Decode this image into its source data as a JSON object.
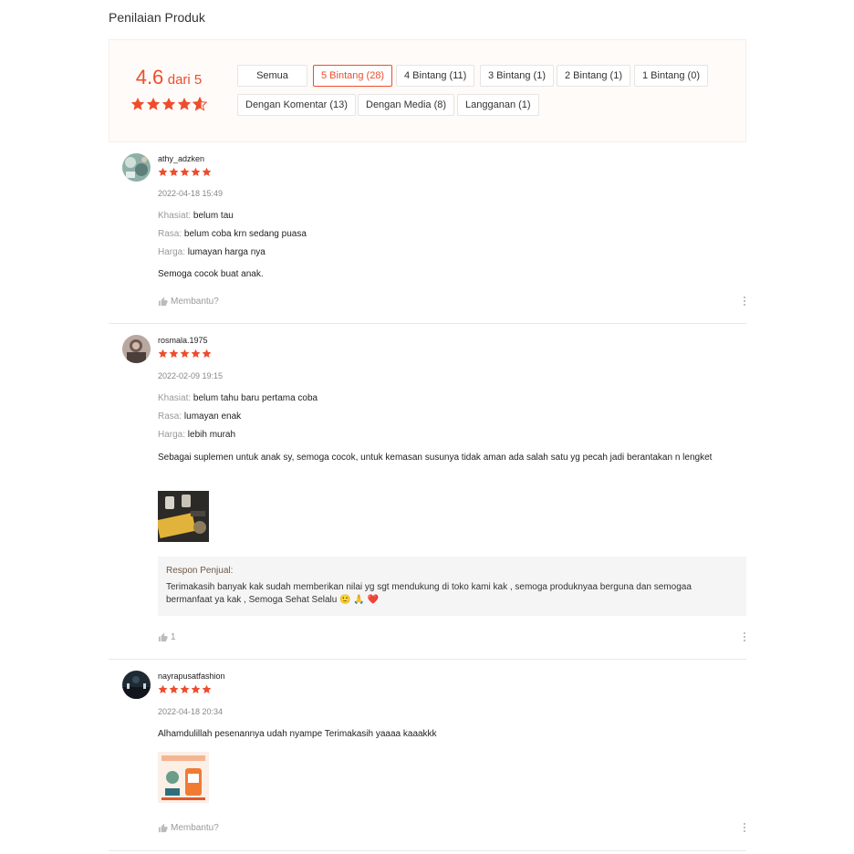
{
  "section_title": "Penilaian Produk",
  "overview": {
    "score": "4.6",
    "score_suffix": "dari 5",
    "rating_value": 4.6,
    "filters": [
      {
        "label": "Semua",
        "active": false
      },
      {
        "label": "5 Bintang (28)",
        "active": true
      },
      {
        "label": "4 Bintang (11)",
        "active": false
      },
      {
        "label": "3 Bintang (1)",
        "active": false
      },
      {
        "label": "2 Bintang (1)",
        "active": false
      },
      {
        "label": "1 Bintang (0)",
        "active": false
      },
      {
        "label": "Dengan Komentar (13)",
        "active": false
      },
      {
        "label": "Dengan Media (8)",
        "active": false
      },
      {
        "label": "Langganan (1)",
        "active": false
      }
    ]
  },
  "colors": {
    "accent": "#ee4d2d",
    "reply_title": "#6d5848"
  },
  "reviews": [
    {
      "username": "athy_adzken",
      "stars": 5,
      "date": "2022-04-18 15:49",
      "attributes": [
        {
          "key": "Khasiat:",
          "value": "belum tau"
        },
        {
          "key": "Rasa:",
          "value": "belum coba krn sedang puasa"
        },
        {
          "key": "Harga:",
          "value": "lumayan harga nya"
        }
      ],
      "comment": "Semoga cocok buat anak.",
      "helpful": "Membantu?",
      "icons": [
        "thumbs-up-icon",
        "more-vertical-icon"
      ]
    },
    {
      "username": "rosmala.1975",
      "stars": 5,
      "date": "2022-02-09 19:15",
      "attributes": [
        {
          "key": "Khasiat:",
          "value": "belum tahu baru pertama coba"
        },
        {
          "key": "Rasa:",
          "value": "lumayan enak"
        },
        {
          "key": "Harga:",
          "value": "lebih murah"
        }
      ],
      "comment": "Sebagai suplemen untuk anak sy, semoga cocok, untuk kemasan susunya  tidak aman ada salah satu yg pecah jadi berantakan n lengket",
      "seller_reply": {
        "title": "Respon Penjual:",
        "text": "Terimakasih banyak kak sudah memberikan nilai yg sgt mendukung di toko kami kak , semoga produknyaa berguna dan semogaa bermanfaat ya kak , Semoga Sehat Selalu 🙂 🙏 ❤️"
      },
      "helpful": "1",
      "icons": [
        "thumbs-up-icon",
        "more-vertical-icon"
      ]
    },
    {
      "username": "nayrapusatfashion",
      "stars": 5,
      "date": "2022-04-18 20:34",
      "comment": "Alhamdulillah pesenannya udah nyampe Terimakasih yaaaa kaaakkk",
      "helpful": "Membantu?",
      "icons": [
        "thumbs-up-icon",
        "more-vertical-icon"
      ]
    }
  ]
}
